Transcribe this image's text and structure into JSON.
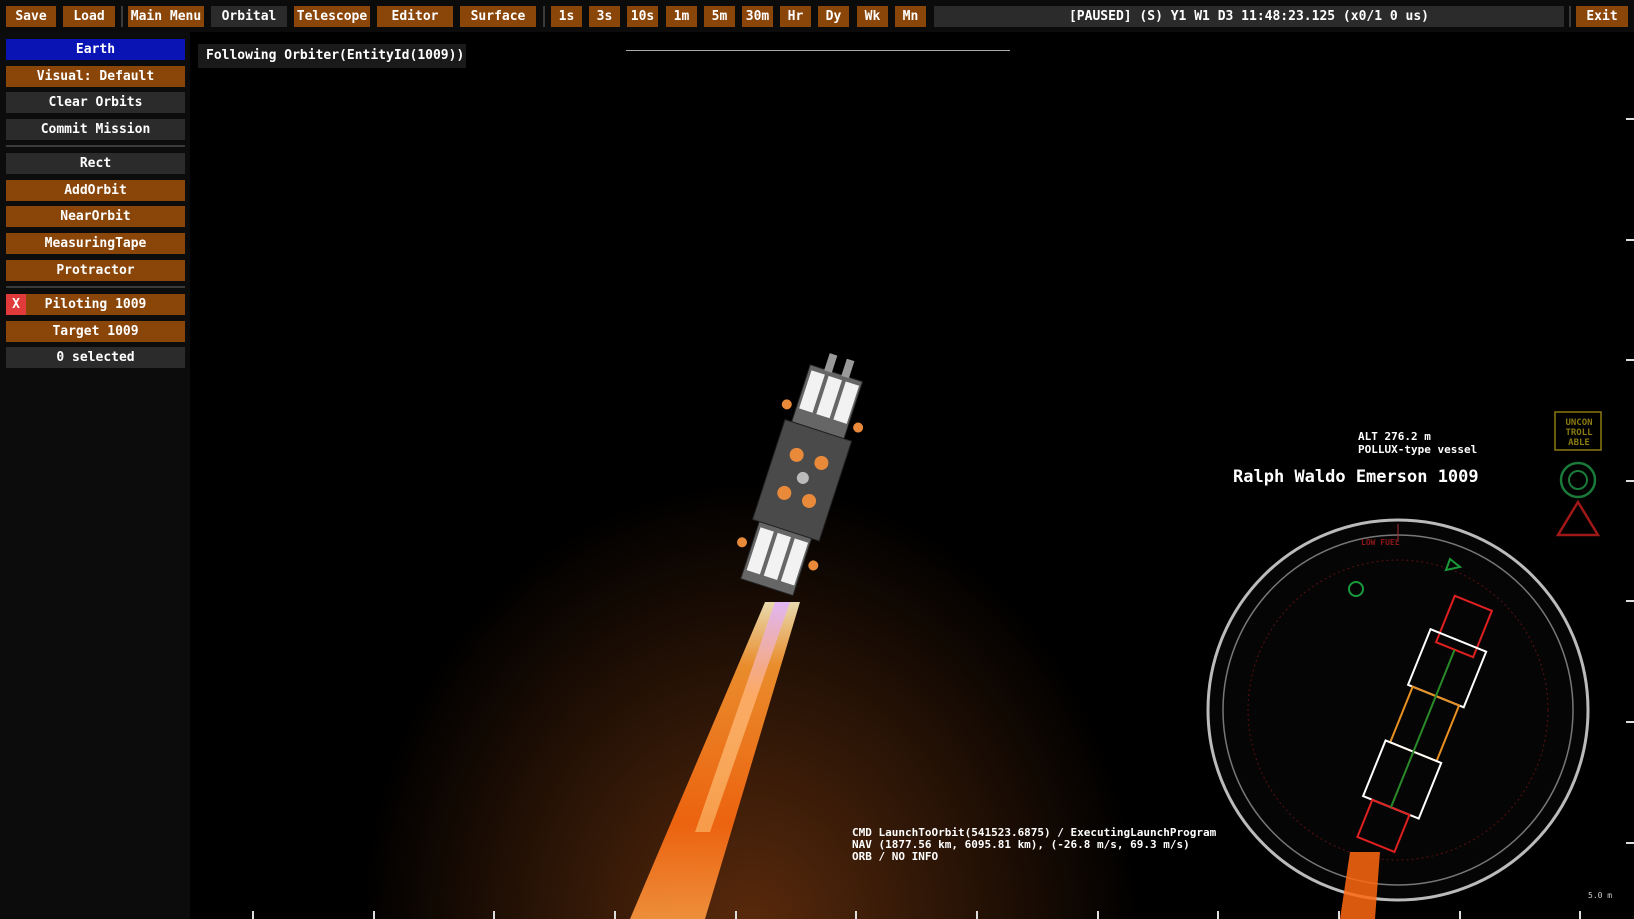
{
  "toolbar": {
    "save": "Save",
    "load": "Load",
    "main_menu": "Main Menu",
    "orbital": "Orbital",
    "telescope": "Telescope",
    "editor": "Editor",
    "surface": "Surface",
    "time_steps": [
      "1s",
      "3s",
      "10s",
      "1m",
      "5m",
      "30m",
      "Hr",
      "Dy",
      "Wk",
      "Mn"
    ],
    "status": "[PAUSED] (S) Y1 W1 D3 11:48:23.125 (x0/1 0 us)",
    "exit": "Exit"
  },
  "sidebar": {
    "body": "Earth",
    "visual": "Visual: Default",
    "clear_orbits": "Clear Orbits",
    "commit_mission": "Commit Mission",
    "rect": "Rect",
    "add_orbit": "AddOrbit",
    "near_orbit": "NearOrbit",
    "measuring_tape": "MeasuringTape",
    "protractor": "Protractor",
    "piloting_close": "X",
    "piloting": "Piloting 1009",
    "target": "Target 1009",
    "selected": "0 selected"
  },
  "viewport": {
    "following": "Following Orbiter(EntityId(1009))",
    "vessel_name": "Ralph Waldo Emerson 1009",
    "altitude": "ALT 276.2 m",
    "vessel_type": "POLLUX-type vessel",
    "cmd": "CMD LaunchToOrbit(541523.6875) / ExecutingLaunchProgram",
    "nav": "NAV (1877.56 km, 6095.81 km), (-26.8 m/s, 69.3 m/s)",
    "orb": "ORB / NO INFO",
    "scale": "5.0 m",
    "indicators": {
      "uncontrollable": "UNCON TROLL ABLE",
      "low_fuel": "LOW FUEL"
    }
  },
  "colors": {
    "orange_button": "#8a4508",
    "gray_button": "#2b2b2b",
    "blue_button": "#0a14b4",
    "red_x": "#e03a3a"
  }
}
